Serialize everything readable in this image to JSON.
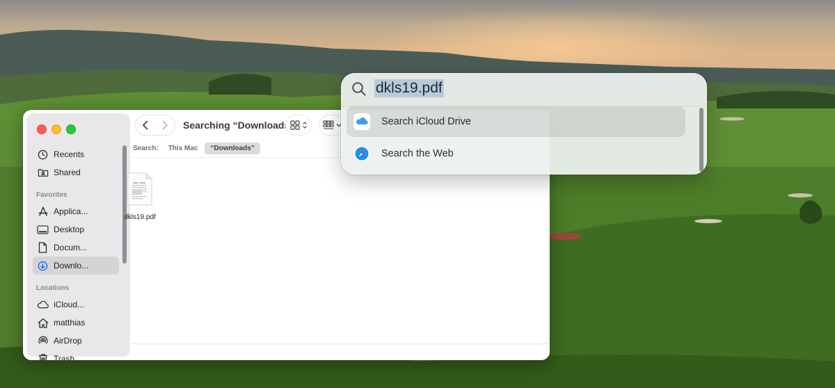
{
  "finder": {
    "title": "Searching “Downloads”",
    "search_label": "Search:",
    "scope_this_mac": "This Mac",
    "scope_downloads": "“Downloads”",
    "sidebar": {
      "items_top": [
        {
          "label": "Recents",
          "icon": "clock-icon"
        },
        {
          "label": "Shared",
          "icon": "shared-folder-icon"
        }
      ],
      "favorites_heading": "Favorites",
      "favorites": [
        {
          "label": "Applica...",
          "icon": "applications-icon"
        },
        {
          "label": "Desktop",
          "icon": "desktop-icon"
        },
        {
          "label": "Docum...",
          "icon": "document-icon"
        },
        {
          "label": "Downlo...",
          "icon": "download-icon",
          "selected": true
        }
      ],
      "locations_heading": "Locations",
      "locations": [
        {
          "label": "iCloud...",
          "icon": "cloud-icon"
        },
        {
          "label": "matthias",
          "icon": "home-icon"
        },
        {
          "label": "AirDrop",
          "icon": "airdrop-icon"
        },
        {
          "label": "Trash",
          "icon": "trash-icon"
        }
      ]
    },
    "files": [
      {
        "name": "dkls19.pdf",
        "icon": "pdf-file-icon"
      }
    ]
  },
  "spotlight": {
    "query": "dkls19.pdf",
    "results": [
      {
        "label": "Search iCloud Drive",
        "icon": "icloud-icon",
        "selected": true
      },
      {
        "label": "Search the Web",
        "icon": "safari-icon",
        "selected": false
      }
    ]
  },
  "colors": {
    "accent": "#0b6cf2",
    "close": "#fe5f57",
    "minimize": "#febc2e",
    "maximize": "#28c840",
    "selection_highlight": "#b6cbd9"
  }
}
